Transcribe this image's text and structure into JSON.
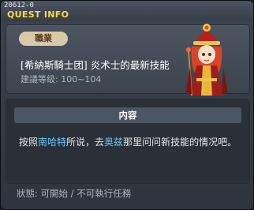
{
  "window": {
    "quest_id": "20612-0",
    "title": "QUEST INFO"
  },
  "quest": {
    "job_tag": "職業",
    "name": "[希納斯騎士团] 炎术士的最新技能",
    "recommended_level": "建議等级: 100~104"
  },
  "content": {
    "header": "内容",
    "desc_part1": "按照",
    "npc1": "南哈特",
    "desc_part2": "所说，去",
    "npc2": "奥兹",
    "desc_part3": "那里问问新技能的情况吧。"
  },
  "status": "狀態:  可開始  /  不可執行任務",
  "icons": {
    "npc_portrait": "blaze-wizard-npc-icon"
  },
  "colors": {
    "title": "#ffd84a",
    "npc_highlight": "#66c8ff",
    "job_tag_bg": "#d9c9a9"
  }
}
